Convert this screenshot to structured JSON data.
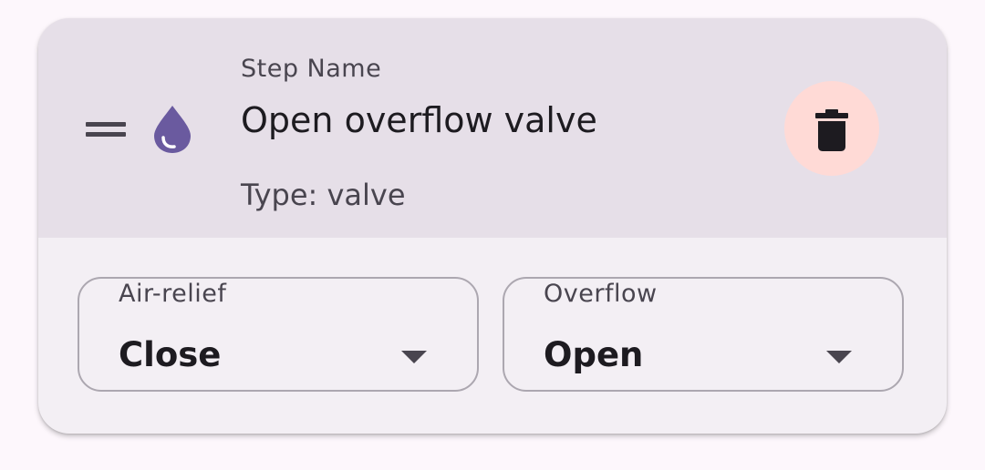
{
  "step": {
    "field_label": "Step Name",
    "name": "Open overflow valve",
    "type_text": "Type: valve",
    "icon": "water-drop-icon",
    "icon_color": "#6a5a9f"
  },
  "actions": {
    "delete_icon": "trash-icon",
    "delete_bg": "#ffdad6"
  },
  "drag_icon": "drag-handle-icon",
  "dropdowns": [
    {
      "label": "Air-relief",
      "value": "Close"
    },
    {
      "label": "Overflow",
      "value": "Open"
    }
  ]
}
